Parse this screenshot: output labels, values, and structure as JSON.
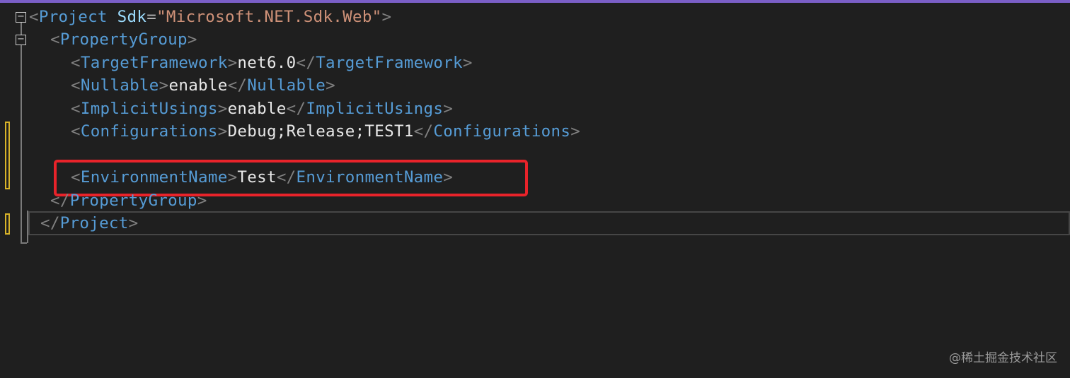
{
  "colors": {
    "background": "#1f1f1f",
    "tag": "#569cd6",
    "bracket": "#808080",
    "attribute": "#9cdcfe",
    "string": "#ce9178",
    "text": "#e8e8e8",
    "highlight": "#e8232a",
    "change_marker": "#d8b329"
  },
  "code": {
    "line1": {
      "open": "<",
      "tag": "Project",
      "attr": "Sdk",
      "eq": "=",
      "value": "\"Microsoft.NET.Sdk.Web\"",
      "close": ">"
    },
    "line2": {
      "open": "<",
      "tag": "PropertyGroup",
      "close": ">"
    },
    "line3": {
      "open": "<",
      "tag": "TargetFramework",
      "close": ">",
      "value": "net6.0",
      "end_open": "</",
      "end_tag": "TargetFramework",
      "end_close": ">"
    },
    "line4": {
      "open": "<",
      "tag": "Nullable",
      "close": ">",
      "value": "enable",
      "end_open": "</",
      "end_tag": "Nullable",
      "end_close": ">"
    },
    "line5": {
      "open": "<",
      "tag": "ImplicitUsings",
      "close": ">",
      "value": "enable",
      "end_open": "</",
      "end_tag": "ImplicitUsings",
      "end_close": ">"
    },
    "line6": {
      "open": "<",
      "tag": "Configurations",
      "close": ">",
      "value": "Debug;Release;TEST1",
      "end_open": "</",
      "end_tag": "Configurations",
      "end_close": ">"
    },
    "line8": {
      "open": "<",
      "tag": "EnvironmentName",
      "close": ">",
      "value": "Test",
      "end_open": "</",
      "end_tag": "EnvironmentName",
      "end_close": ">"
    },
    "line9": {
      "end_open": "</",
      "end_tag": "PropertyGroup",
      "end_close": ">"
    },
    "line10": {
      "end_open": "</",
      "end_tag": "Project",
      "end_close": ">"
    }
  },
  "gutter": {
    "fold_symbol": "−"
  },
  "watermark": "@稀土掘金技术社区"
}
